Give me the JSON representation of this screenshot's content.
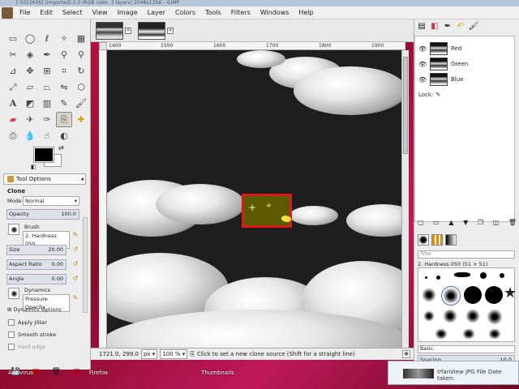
{
  "window": {
    "title": "[-5022606] (imported)-2.0 (RGB color, 3 layers) 2048x1356 – GIMP"
  },
  "menu": [
    "File",
    "Edit",
    "Select",
    "View",
    "Image",
    "Layer",
    "Colors",
    "Tools",
    "Filters",
    "Windows",
    "Help"
  ],
  "toolbox": {
    "tools": [
      "rect-select",
      "ellipse-select",
      "free-select",
      "fuzzy-select",
      "color-select",
      "scissors",
      "foreground-select",
      "paths",
      "color-picker",
      "zoom",
      "measure",
      "move",
      "align",
      "crop",
      "rotate",
      "scale",
      "shear",
      "perspective",
      "flip",
      "cage",
      "text",
      "bucket-fill",
      "blend",
      "pencil",
      "paintbrush",
      "eraser",
      "airbrush",
      "ink",
      "clone",
      "heal",
      "perspective-clone",
      "blur",
      "smudge",
      "dodge-burn"
    ],
    "active_tool": "clone",
    "fg_color": "#000000",
    "bg_color": "#ffffff"
  },
  "tool_options": {
    "tab_label": "Tool Options",
    "title": "Clone",
    "mode_label": "Mode",
    "mode_value": "Normal",
    "opacity_label": "Opacity",
    "opacity_value": "100.0",
    "brush_label": "Brush",
    "brush_value": "2. Hardness 050",
    "size_label": "Size",
    "size_value": "20.00",
    "aspect_label": "Aspect Ratio",
    "aspect_value": "0.00",
    "angle_label": "Angle",
    "angle_value": "0.00",
    "dynamics_label": "Dynamics",
    "dynamics_value": "Pressure Opacity",
    "dynamics_options_label": "Dynamics Options",
    "apply_jitter_label": "Apply Jitter",
    "smooth_stroke_label": "Smooth stroke",
    "hard_edge_label": "Hard edge"
  },
  "ruler": {
    "top_ticks": [
      "1400",
      "1500",
      "1600",
      "1700",
      "1800",
      "1900"
    ]
  },
  "statusbar": {
    "coords": "1721.0, 299.0",
    "unit": "px",
    "zoom": "100 %",
    "message": "Click to set a new clone source (Shift for a straight line)"
  },
  "channels": {
    "items": [
      {
        "name": "Red"
      },
      {
        "name": "Green"
      },
      {
        "name": "Blue"
      }
    ],
    "lock_label": "Lock:"
  },
  "brushes": {
    "filter_placeholder": "filter",
    "selected_name": "2. Hardness 050 (51 × 51)",
    "tag_value": "Basic,",
    "spacing_label": "Spacing",
    "spacing_value": "10.0"
  },
  "taskbar": {
    "labels": [
      "Antivirus",
      "Firefox",
      "Thumbnails"
    ],
    "viewer_title": "IrfanView JPG File  Date taken:"
  }
}
